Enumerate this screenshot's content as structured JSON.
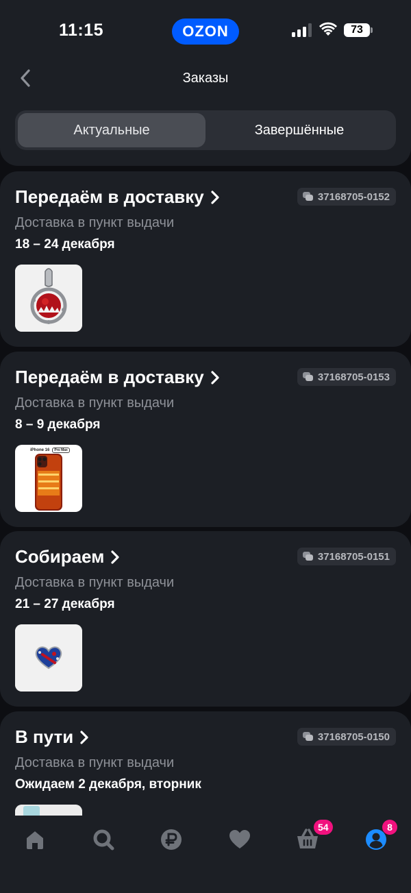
{
  "status_bar": {
    "time": "11:15",
    "brand": "OZON",
    "battery": "73"
  },
  "header": {
    "title": "Заказы",
    "tabs": [
      {
        "label": "Актуальные",
        "active": true
      },
      {
        "label": "Завершённые",
        "active": false
      }
    ]
  },
  "orders": [
    {
      "status": "Передаём в доставку",
      "order_number": "37168705-0152",
      "delivery_type": "Доставка в пункт выдачи",
      "delivery_date": "18 – 24 декабря",
      "thumb": "pendant-charm"
    },
    {
      "status": "Передаём в доставку",
      "order_number": "37168705-0153",
      "delivery_type": "Доставка в пункт выдачи",
      "delivery_date": "8 – 9 декабря",
      "thumb": "iphone-case",
      "thumb_label": "iPhone 16",
      "thumb_tag": "Pro Max"
    },
    {
      "status": "Собираем",
      "order_number": "37168705-0151",
      "delivery_type": "Доставка в пункт выдачи",
      "delivery_date": "21 – 27 декабря",
      "thumb": "heart-charm"
    },
    {
      "status": "В пути",
      "order_number": "37168705-0150",
      "delivery_type": "Доставка в пункт выдачи",
      "delivery_date": "Ожидаем 2 декабря, вторник",
      "thumb": "partial-item"
    }
  ],
  "bottom_nav": {
    "items": [
      {
        "icon": "home-icon",
        "active": false
      },
      {
        "icon": "search-icon",
        "active": false
      },
      {
        "icon": "ruble-icon",
        "active": false
      },
      {
        "icon": "heart-icon",
        "active": false
      },
      {
        "icon": "cart-icon",
        "active": false,
        "badge": "54"
      },
      {
        "icon": "profile-icon",
        "active": true,
        "badge": "8"
      }
    ]
  },
  "colors": {
    "background": "#0d0e12",
    "surface": "#1c1f25",
    "brand": "#005bff",
    "badge": "#f1117e",
    "muted_text": "#8e9198"
  }
}
